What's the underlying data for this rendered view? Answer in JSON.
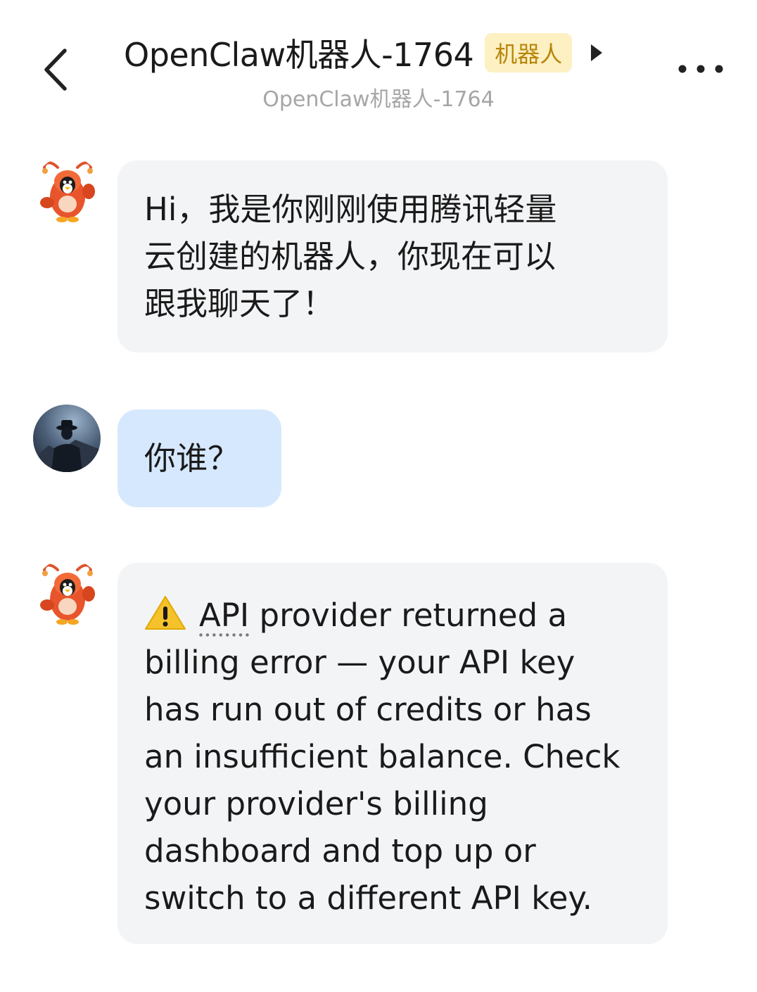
{
  "header": {
    "title": "OpenClaw机器人-1764",
    "badge": "机器人",
    "subtitle": "OpenClaw机器人-1764",
    "back_icon": "chevron-left-icon",
    "expand_icon": "play-triangle-icon",
    "more_icon": "more-dots-icon"
  },
  "messages": [
    {
      "sender": "bot",
      "avatar_icon": "lobster-mascot-icon",
      "text": "Hi，我是你刚刚使用腾讯轻量\n云创建的机器人，你现在可以\n跟我聊天了！"
    },
    {
      "sender": "me",
      "avatar_icon": "user-avatar-photo",
      "text": "你谁？"
    },
    {
      "sender": "bot",
      "avatar_icon": "lobster-mascot-icon",
      "icon": "warning-icon",
      "text_term": "API",
      "text_rest": " provider returned a\nbilling error — your API key\nhas run out of credits or has\nan insufficient balance. Check\nyour provider's billing\ndashboard and top up or\nswitch to a different API key."
    }
  ],
  "colors": {
    "badge_bg": "#fdf0c2",
    "badge_text": "#b8860b",
    "bot_bubble": "#f3f4f6",
    "user_bubble": "#d6e8fd",
    "subtitle": "#a6a6a6"
  }
}
